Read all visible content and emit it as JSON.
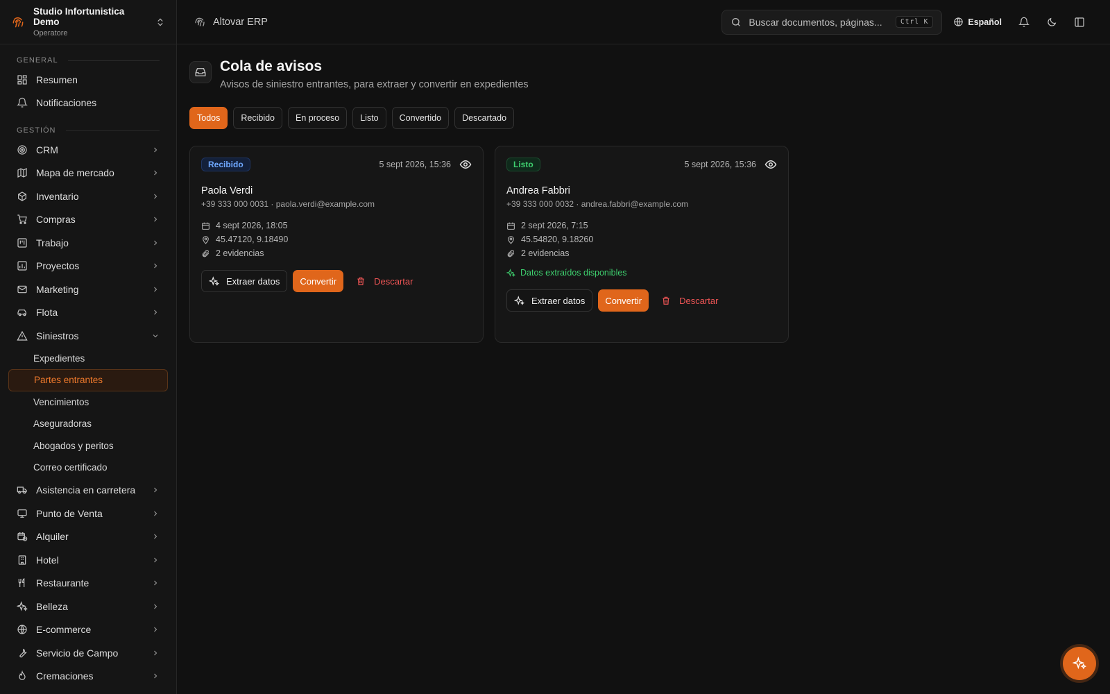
{
  "org": {
    "name": "Studio Infortunistica Demo",
    "role": "Operatore"
  },
  "sections": {
    "general": "GENERAL",
    "management": "GESTIÓN"
  },
  "nav": {
    "summary": "Resumen",
    "notifications": "Notificaciones",
    "crm": "CRM",
    "market_map": "Mapa de mercado",
    "inventory": "Inventario",
    "purchases": "Compras",
    "work": "Trabajo",
    "projects": "Proyectos",
    "marketing": "Marketing",
    "fleet": "Flota",
    "claims": "Siniestros",
    "claims_sub": [
      "Expedientes",
      "Partes entrantes",
      "Vencimientos",
      "Aseguradoras",
      "Abogados y peritos",
      "Correo certificado"
    ],
    "roadside": "Asistencia en carretera",
    "pos": "Punto de Venta",
    "rental": "Alquiler",
    "hotel": "Hotel",
    "restaurant": "Restaurante",
    "beauty": "Belleza",
    "ecommerce": "E-commerce",
    "field_service": "Servicio de Campo",
    "cremations": "Cremaciones"
  },
  "topbar": {
    "app": "Altovar ERP",
    "search_placeholder": "Buscar documentos, páginas...",
    "shortcut": "Ctrl K",
    "language": "Español"
  },
  "page": {
    "title": "Cola de avisos",
    "subtitle": "Avisos de siniestro entrantes, para extraer y convertir en expedientes"
  },
  "filters": [
    "Todos",
    "Recibido",
    "En proceso",
    "Listo",
    "Convertido",
    "Descartado"
  ],
  "cards": [
    {
      "status": "Recibido",
      "received": "5 sept 2026, 15:36",
      "name": "Paola Verdi",
      "contact": "+39 333 000 0031 · paola.verdi@example.com",
      "date": "4 sept 2026, 18:05",
      "coords": "45.47120, 9.18490",
      "evidence": "2 evidencias"
    },
    {
      "status": "Listo",
      "received": "5 sept 2026, 15:36",
      "name": "Andrea Fabbri",
      "contact": "+39 333 000 0032 · andrea.fabbri@example.com",
      "date": "2 sept 2026, 7:15",
      "coords": "45.54820, 9.18260",
      "evidence": "2 evidencias",
      "extracted_note": "Datos extraídos disponibles"
    }
  ],
  "actions": {
    "extract": "Extraer datos",
    "convert": "Convertir",
    "discard": "Descartar"
  },
  "colors": {
    "accent": "#e0661b",
    "received": "#6fa8ff",
    "ready": "#3ecf6e",
    "danger": "#ef5555"
  }
}
